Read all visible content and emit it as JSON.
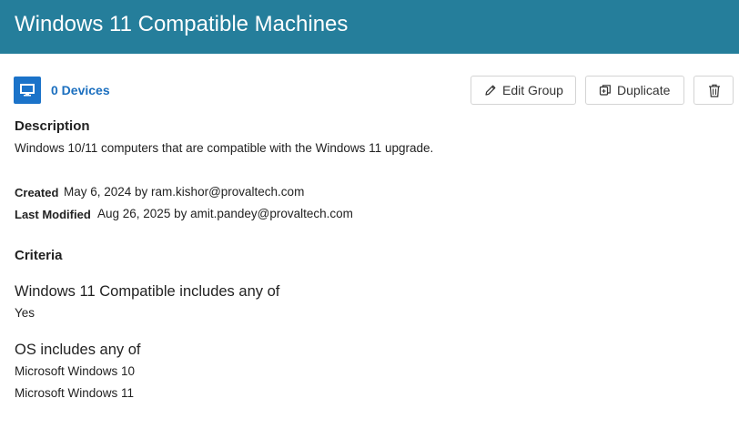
{
  "header": {
    "title": "Windows 11 Compatible Machines"
  },
  "devices": {
    "icon": "monitor-icon",
    "label": "0 Devices"
  },
  "actions": {
    "edit_label": "Edit Group",
    "duplicate_label": "Duplicate",
    "delete_icon": "trash-icon"
  },
  "description": {
    "heading": "Description",
    "text": "Windows 10/11 computers that are compatible with the Windows 11 upgrade."
  },
  "meta": {
    "created_label": "Created",
    "created_value": "May 6, 2024 by ram.kishor@provaltech.com",
    "modified_label": "Last Modified",
    "modified_value": "Aug 26, 2025 by amit.pandey@provaltech.com"
  },
  "criteria": {
    "heading": "Criteria",
    "items": [
      {
        "title": "Windows 11 Compatible includes any of",
        "values": [
          "Yes"
        ]
      },
      {
        "title": "OS includes any of",
        "values": [
          "Microsoft Windows 10",
          "Microsoft Windows 11"
        ]
      }
    ]
  },
  "colors": {
    "header_bg": "#257e9b",
    "accent": "#1b73c9",
    "link": "#1b6fbf"
  }
}
